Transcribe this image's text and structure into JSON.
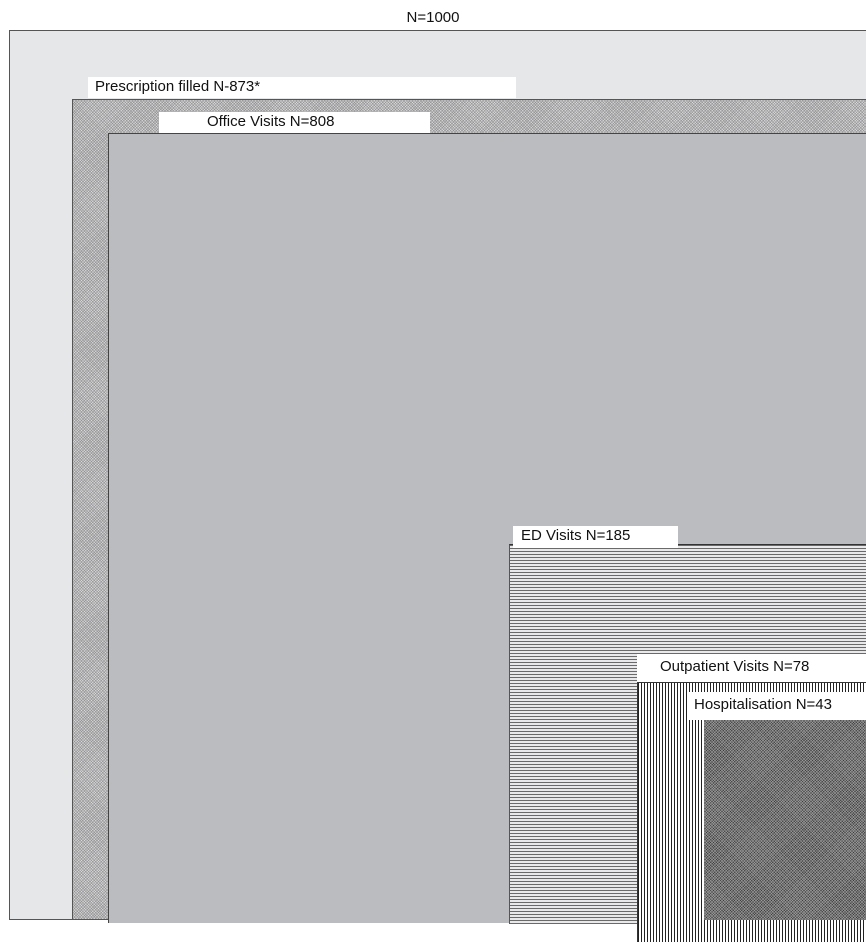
{
  "diagram": {
    "total": {
      "label": "N=1000"
    },
    "prescription": {
      "label": "Prescription filled   N-873*"
    },
    "office_visits": {
      "label": "Office Visits   N=808"
    },
    "ed_visits": {
      "label": "ED Visits  N=185"
    },
    "outpatient_visits": {
      "label": "Outpatient Visits  N=78"
    },
    "hospitalisation": {
      "label": "Hospitalisation N=43"
    }
  }
}
